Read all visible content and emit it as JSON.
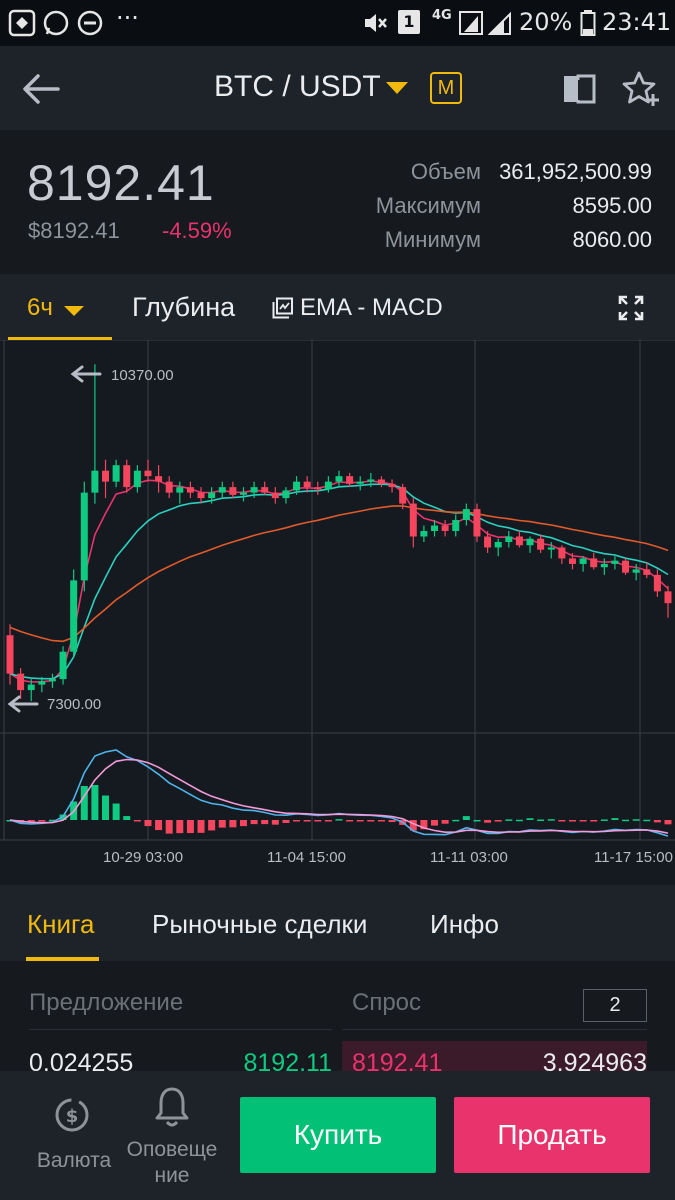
{
  "status_bar": {
    "signal": "4G",
    "sim": "1",
    "battery": "20%",
    "time": "23:41",
    "dots": "···"
  },
  "header": {
    "pair": "BTC / USDT",
    "badge": "M"
  },
  "ticker": {
    "last_price": "8192.41",
    "usd_price": "$8192.41",
    "change": "-4.59%",
    "volume_label": "Объем",
    "volume": "361,952,500.99",
    "high_label": "Максимум",
    "high": "8595.00",
    "low_label": "Минимум",
    "low": "8060.00"
  },
  "chart_toolbar": {
    "interval": "6ч",
    "depth": "Глубина",
    "indicators": "EMA - MACD"
  },
  "chart_data": {
    "type": "candlestick",
    "interval": "6h",
    "price_max_marker": "10370.00",
    "price_min_marker": "7300.00",
    "x_tick_labels": [
      "10-29 03:00",
      "11-04 15:00",
      "11-11 03:00",
      "11-17 15:00"
    ],
    "price_range": [
      7300,
      10370
    ],
    "indicators": [
      "EMA",
      "MACD"
    ],
    "colors": {
      "up": "#0ecb81",
      "down": "#f6465d",
      "ema_fast": "#e8336c",
      "ema_mid": "#2bd1c0",
      "ema_slow": "#e05a2b",
      "macd_line": "#4fb3ea",
      "signal_line": "#f39ad8",
      "grid": "#3a3f48"
    },
    "candles_ohlc_approx": [
      [
        7900,
        8000,
        7450,
        7550
      ],
      [
        7550,
        7600,
        7320,
        7400
      ],
      [
        7400,
        7500,
        7300,
        7450
      ],
      [
        7450,
        7520,
        7380,
        7480
      ],
      [
        7480,
        7550,
        7420,
        7500
      ],
      [
        7500,
        7800,
        7450,
        7750
      ],
      [
        7750,
        8500,
        7700,
        8400
      ],
      [
        8400,
        9300,
        8300,
        9200
      ],
      [
        9200,
        10370,
        9100,
        9400
      ],
      [
        9400,
        9500,
        9150,
        9300
      ],
      [
        9300,
        9500,
        9250,
        9450
      ],
      [
        9450,
        9500,
        9200,
        9250
      ],
      [
        9250,
        9450,
        9200,
        9400
      ],
      [
        9400,
        9500,
        9300,
        9350
      ],
      [
        9350,
        9450,
        9200,
        9300
      ],
      [
        9300,
        9350,
        9150,
        9200
      ],
      [
        9200,
        9300,
        9100,
        9250
      ],
      [
        9250,
        9300,
        9150,
        9200
      ],
      [
        9200,
        9250,
        9100,
        9150
      ],
      [
        9150,
        9250,
        9100,
        9200
      ],
      [
        9200,
        9300,
        9150,
        9250
      ],
      [
        9250,
        9300,
        9150,
        9180
      ],
      [
        9180,
        9250,
        9120,
        9200
      ],
      [
        9200,
        9300,
        9150,
        9250
      ],
      [
        9250,
        9300,
        9180,
        9200
      ],
      [
        9200,
        9250,
        9100,
        9150
      ],
      [
        9150,
        9250,
        9100,
        9220
      ],
      [
        9220,
        9350,
        9180,
        9300
      ],
      [
        9300,
        9350,
        9200,
        9250
      ],
      [
        9250,
        9300,
        9180,
        9230
      ],
      [
        9230,
        9350,
        9200,
        9300
      ],
      [
        9300,
        9400,
        9250,
        9350
      ],
      [
        9350,
        9380,
        9250,
        9280
      ],
      [
        9280,
        9350,
        9220,
        9300
      ],
      [
        9300,
        9380,
        9250,
        9320
      ],
      [
        9320,
        9350,
        9250,
        9280
      ],
      [
        9280,
        9320,
        9200,
        9250
      ],
      [
        9250,
        9280,
        9050,
        9100
      ],
      [
        9100,
        9150,
        8700,
        8800
      ],
      [
        8800,
        8900,
        8750,
        8850
      ],
      [
        8850,
        8950,
        8800,
        8900
      ],
      [
        8900,
        8950,
        8800,
        8850
      ],
      [
        8850,
        9000,
        8800,
        8950
      ],
      [
        8950,
        9100,
        8900,
        9050
      ],
      [
        9050,
        9100,
        8750,
        8800
      ],
      [
        8800,
        8850,
        8650,
        8700
      ],
      [
        8700,
        8780,
        8620,
        8750
      ],
      [
        8750,
        8850,
        8700,
        8800
      ],
      [
        8800,
        8850,
        8700,
        8720
      ],
      [
        8720,
        8800,
        8650,
        8780
      ],
      [
        8780,
        8820,
        8650,
        8680
      ],
      [
        8680,
        8750,
        8600,
        8700
      ],
      [
        8700,
        8720,
        8550,
        8600
      ],
      [
        8600,
        8650,
        8500,
        8550
      ],
      [
        8550,
        8620,
        8480,
        8600
      ],
      [
        8600,
        8650,
        8500,
        8520
      ],
      [
        8520,
        8600,
        8450,
        8550
      ],
      [
        8550,
        8620,
        8500,
        8580
      ],
      [
        8580,
        8600,
        8450,
        8470
      ],
      [
        8470,
        8550,
        8400,
        8500
      ],
      [
        8500,
        8560,
        8420,
        8450
      ],
      [
        8450,
        8500,
        8250,
        8300
      ],
      [
        8300,
        8350,
        8060,
        8192
      ]
    ]
  },
  "book_tabs": {
    "book": "Книга",
    "trades": "Рыночные сделки",
    "info": "Инфо"
  },
  "order_book": {
    "bid_header": "Предложение",
    "ask_header": "Спрос",
    "depth_value": "2",
    "bid_qty": "0.024255",
    "bid_price": "8192.11",
    "ask_price": "8192.41",
    "ask_qty": "3.924963"
  },
  "bottom_nav": {
    "currency": "Валюта",
    "alerts": "Оповеще\nние",
    "buy": "Купить",
    "sell": "Продать"
  }
}
